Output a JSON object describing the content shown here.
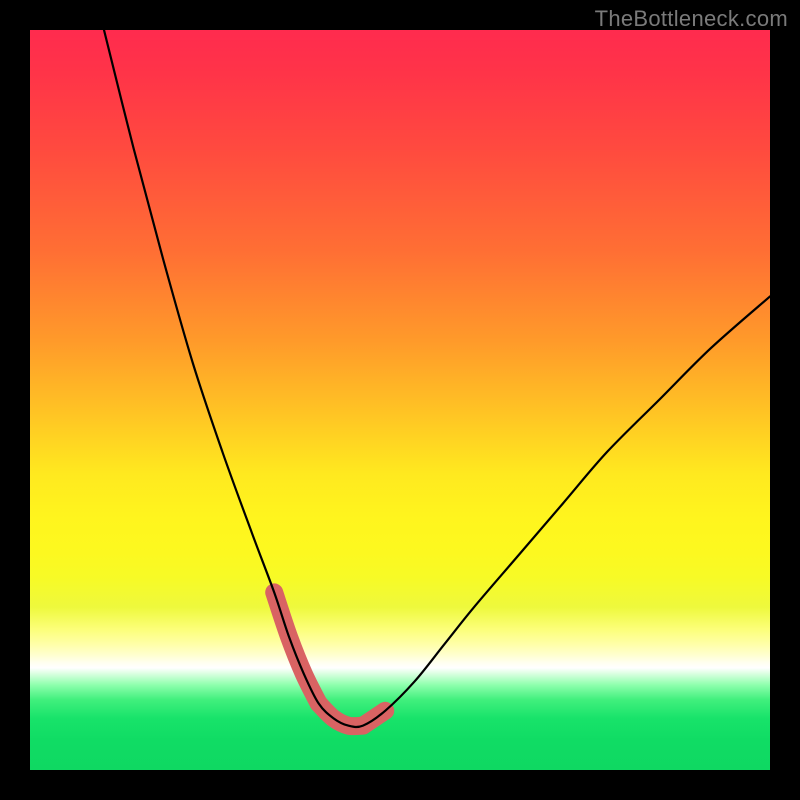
{
  "watermark": "TheBottleneck.com",
  "colors": {
    "page_bg": "#000000",
    "watermark": "#7a7a7a",
    "curve": "#000000",
    "marker": "#d96363"
  },
  "chart_data": {
    "type": "line",
    "title": "",
    "xlabel": "",
    "ylabel": "",
    "xlim": [
      0,
      100
    ],
    "ylim": [
      0,
      100
    ],
    "grid": false,
    "legend": false,
    "series": [
      {
        "name": "bottleneck-curve",
        "x": [
          10,
          14,
          18,
          22,
          26,
          30,
          33,
          35,
          37,
          39,
          41,
          43,
          45,
          48,
          52,
          56,
          60,
          66,
          72,
          78,
          85,
          92,
          100
        ],
        "y": [
          100,
          84,
          69,
          55,
          43,
          32,
          24,
          18,
          13,
          9,
          7,
          6,
          6,
          8,
          12,
          17,
          22,
          29,
          36,
          43,
          50,
          57,
          64
        ]
      }
    ],
    "annotations": [
      {
        "type": "highlighted-range",
        "description": "thick salmon markers near minimum",
        "x_range": [
          33,
          48
        ],
        "color": "#d96363"
      }
    ],
    "background_gradient": {
      "orientation": "vertical",
      "stops": [
        {
          "pos": 0.0,
          "color": "#ff2b4e"
        },
        {
          "pos": 0.3,
          "color": "#ff6f34"
        },
        {
          "pos": 0.6,
          "color": "#ffe91f"
        },
        {
          "pos": 0.86,
          "color": "#ffffff"
        },
        {
          "pos": 1.0,
          "color": "#0fd862"
        }
      ]
    }
  }
}
